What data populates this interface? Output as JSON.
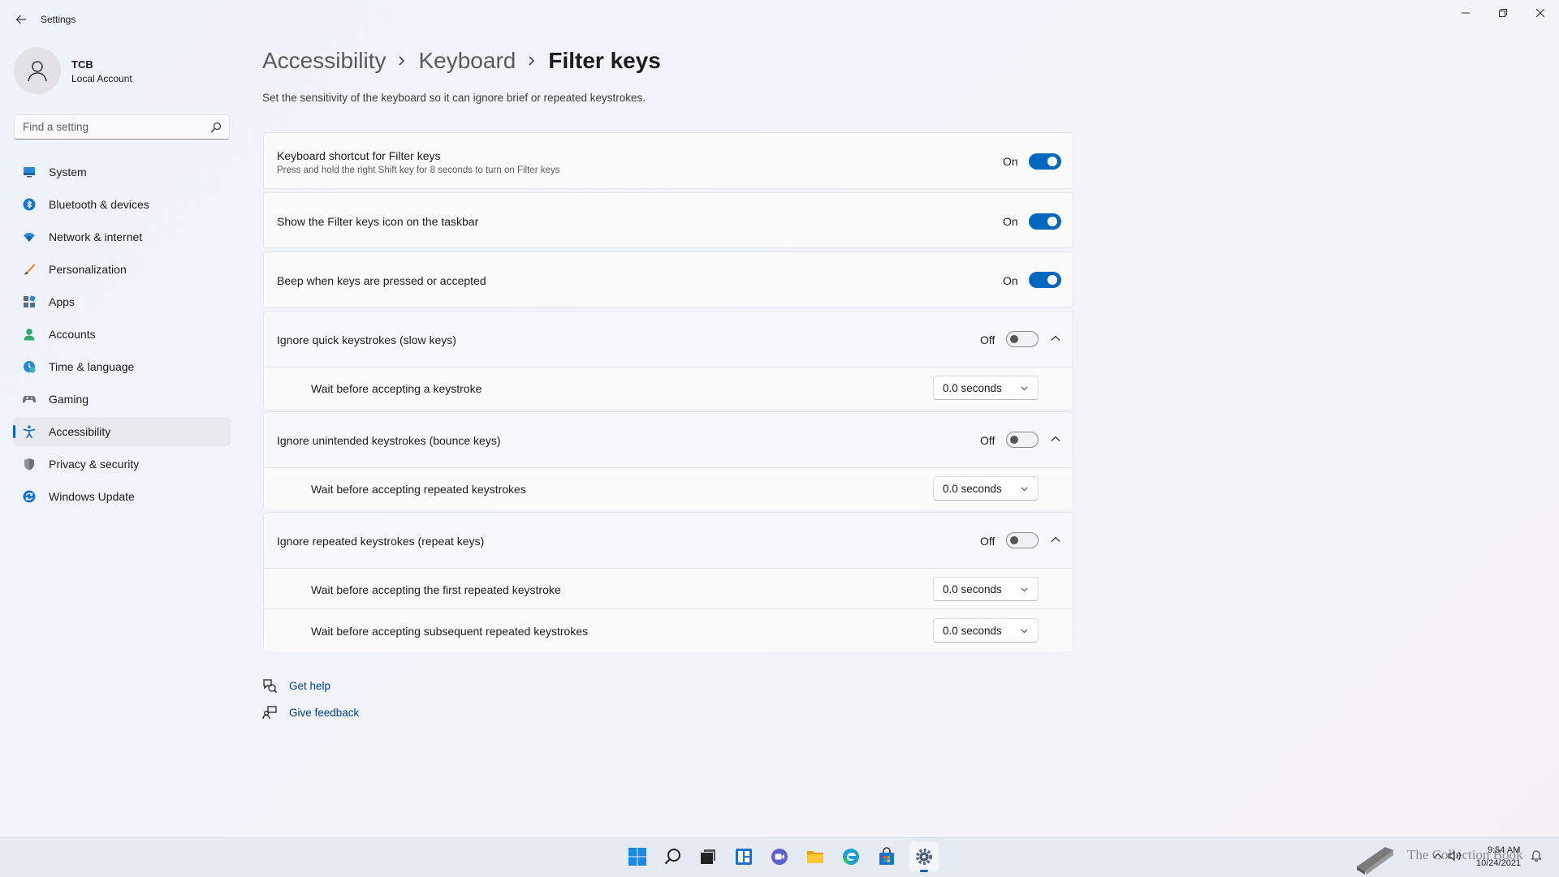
{
  "window": {
    "app_title": "Settings"
  },
  "profile": {
    "name": "TCB",
    "account_type": "Local Account"
  },
  "search": {
    "placeholder": "Find a setting",
    "value": ""
  },
  "sidebar": {
    "items": [
      {
        "label": "System",
        "icon": "monitor-icon"
      },
      {
        "label": "Bluetooth & devices",
        "icon": "bluetooth-icon"
      },
      {
        "label": "Network & internet",
        "icon": "wifi-icon"
      },
      {
        "label": "Personalization",
        "icon": "brush-icon"
      },
      {
        "label": "Apps",
        "icon": "apps-icon"
      },
      {
        "label": "Accounts",
        "icon": "person-icon"
      },
      {
        "label": "Time & language",
        "icon": "globe-clock-icon"
      },
      {
        "label": "Gaming",
        "icon": "gamepad-icon"
      },
      {
        "label": "Accessibility",
        "icon": "accessibility-icon",
        "active": true
      },
      {
        "label": "Privacy & security",
        "icon": "shield-icon"
      },
      {
        "label": "Windows Update",
        "icon": "update-icon"
      }
    ]
  },
  "breadcrumb": {
    "level1": "Accessibility",
    "level2": "Keyboard",
    "current": "Filter keys"
  },
  "page": {
    "description": "Set the sensitivity of the keyboard so it can ignore brief or repeated keystrokes."
  },
  "settings": {
    "shortcut": {
      "title": "Keyboard shortcut for Filter keys",
      "subtitle": "Press and hold the right Shift key for 8 seconds to turn on Filter keys",
      "state_label": "On",
      "enabled": true
    },
    "taskbar_icon": {
      "title": "Show the Filter keys icon on the taskbar",
      "state_label": "On",
      "enabled": true
    },
    "beep": {
      "title": "Beep when keys are pressed or accepted",
      "state_label": "On",
      "enabled": true
    },
    "slow_keys": {
      "title": "Ignore quick keystrokes (slow keys)",
      "state_label": "Off",
      "enabled": false,
      "wait_label": "Wait before accepting a keystroke",
      "wait_value": "0.0 seconds"
    },
    "bounce_keys": {
      "title": "Ignore unintended keystrokes (bounce keys)",
      "state_label": "Off",
      "enabled": false,
      "wait_label": "Wait before accepting repeated keystrokes",
      "wait_value": "0.0 seconds"
    },
    "repeat_keys": {
      "title": "Ignore repeated keystrokes (repeat keys)",
      "state_label": "Off",
      "enabled": false,
      "first_label": "Wait before accepting the first repeated keystroke",
      "first_value": "0.0 seconds",
      "subsequent_label": "Wait before accepting subsequent repeated keystrokes",
      "subsequent_value": "0.0 seconds"
    }
  },
  "links": {
    "help": "Get help",
    "feedback": "Give feedback"
  },
  "taskbar": {
    "watermark": "The Collection Book",
    "time": "9:54 AM",
    "date": "10/24/2021"
  },
  "colors": {
    "accent": "#0067c0",
    "link": "#003e92"
  }
}
